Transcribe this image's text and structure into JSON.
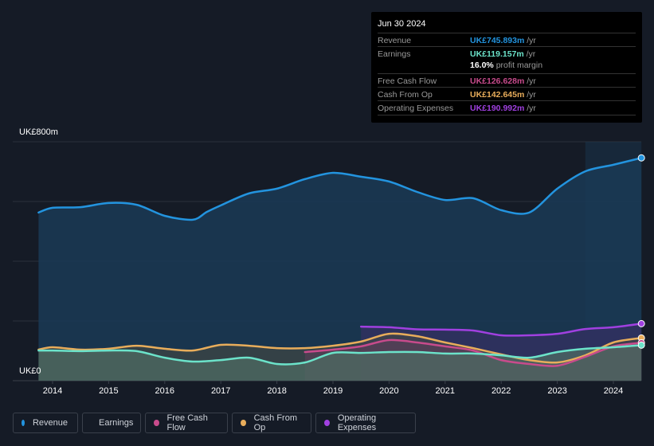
{
  "tooltip": {
    "date": "Jun 30 2024",
    "rows": [
      {
        "label": "Revenue",
        "value": "UK£745.893m",
        "unit": " /yr",
        "color": "#2394df"
      },
      {
        "label": "Earnings",
        "value": "UK£119.157m",
        "unit": " /yr",
        "color": "#6ce3ca"
      },
      {
        "label": "Free Cash Flow",
        "value": "UK£126.628m",
        "unit": " /yr",
        "color": "#c84b8c"
      },
      {
        "label": "Cash From Op",
        "value": "UK£142.645m",
        "unit": " /yr",
        "color": "#e8ad5b"
      },
      {
        "label": "Operating Expenses",
        "value": "UK£190.992m",
        "unit": " /yr",
        "color": "#a040e0"
      }
    ],
    "margin_value": "16.0%",
    "margin_label": " profit margin"
  },
  "legend": [
    {
      "label": "Revenue",
      "color": "#2394df"
    },
    {
      "label": "Earnings",
      "color": "#6ce3ca"
    },
    {
      "label": "Free Cash Flow",
      "color": "#c84b8c"
    },
    {
      "label": "Cash From Op",
      "color": "#e8ad5b"
    },
    {
      "label": "Operating Expenses",
      "color": "#a040e0"
    }
  ],
  "chart_data": {
    "type": "area",
    "title": "",
    "xlabel": "",
    "ylabel": "",
    "ylim": [
      0,
      800
    ],
    "xlim": [
      2013.75,
      2024.5
    ],
    "y_tick_labels": [
      {
        "value": 800,
        "label": "UK£800m"
      },
      {
        "value": 0,
        "label": "UK£0"
      }
    ],
    "gridlines_y": [
      0,
      200,
      400,
      600,
      800
    ],
    "x_tick_labels": [
      "2014",
      "2015",
      "2016",
      "2017",
      "2018",
      "2019",
      "2020",
      "2021",
      "2022",
      "2023",
      "2024"
    ],
    "x_ticks": [
      2014,
      2015,
      2016,
      2017,
      2018,
      2019,
      2020,
      2021,
      2022,
      2023,
      2024
    ],
    "highlight_range": [
      2023.5,
      2024.5
    ],
    "legend_position": "bottom-left",
    "series": [
      {
        "name": "Revenue",
        "color": "#2394df",
        "x": [
          2013.75,
          2014,
          2014.5,
          2015,
          2015.5,
          2016,
          2016.5,
          2016.75,
          2017,
          2017.5,
          2018,
          2018.5,
          2019,
          2019.5,
          2020,
          2020.5,
          2021,
          2021.5,
          2022,
          2022.5,
          2023,
          2023.5,
          2024,
          2024.5
        ],
        "values": [
          563,
          579,
          581,
          595,
          589,
          552,
          539,
          565,
          587,
          627,
          643,
          675,
          696,
          683,
          667,
          632,
          605,
          611,
          571,
          563,
          643,
          701,
          723,
          746
        ]
      },
      {
        "name": "Earnings",
        "color": "#6ce3ca",
        "x": [
          2013.75,
          2014,
          2014.5,
          2015,
          2015.5,
          2016,
          2016.5,
          2017,
          2017.5,
          2018,
          2018.5,
          2019,
          2019.5,
          2020,
          2020.5,
          2021,
          2021.5,
          2022,
          2022.5,
          2023,
          2023.5,
          2024,
          2024.5
        ],
        "values": [
          101,
          101,
          99,
          101,
          99,
          77,
          64,
          69,
          77,
          56,
          61,
          93,
          93,
          96,
          96,
          91,
          91,
          85,
          77,
          96,
          107,
          112,
          119
        ]
      },
      {
        "name": "Free Cash Flow",
        "color": "#c84b8c",
        "x": [
          2018.5,
          2019,
          2019.5,
          2020,
          2020.5,
          2021,
          2021.5,
          2022,
          2022.5,
          2023,
          2023.5,
          2024,
          2024.5
        ],
        "values": [
          96,
          104,
          115,
          136,
          128,
          115,
          101,
          69,
          56,
          50,
          80,
          115,
          127
        ]
      },
      {
        "name": "Cash From Op",
        "color": "#e8ad5b",
        "x": [
          2013.75,
          2014,
          2014.5,
          2015,
          2015.5,
          2016,
          2016.5,
          2017,
          2017.5,
          2018,
          2018.5,
          2019,
          2019.5,
          2020,
          2020.5,
          2021,
          2021.5,
          2022,
          2022.5,
          2023,
          2023.5,
          2024,
          2024.5
        ],
        "values": [
          104,
          112,
          104,
          107,
          117,
          107,
          101,
          120,
          117,
          109,
          109,
          117,
          131,
          157,
          149,
          128,
          109,
          88,
          69,
          61,
          85,
          128,
          143
        ]
      },
      {
        "name": "Operating Expenses",
        "color": "#a040e0",
        "x": [
          2019.5,
          2020,
          2020.5,
          2021,
          2021.5,
          2022,
          2022.5,
          2023,
          2023.5,
          2024,
          2024.5
        ],
        "values": [
          181,
          179,
          172,
          171,
          168,
          152,
          152,
          157,
          173,
          179,
          191
        ]
      }
    ]
  }
}
